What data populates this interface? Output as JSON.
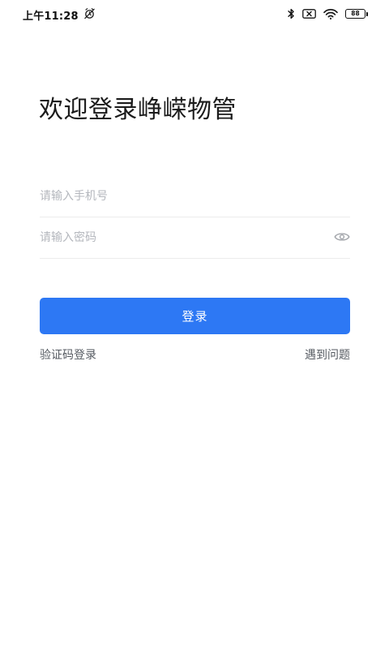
{
  "status_bar": {
    "time": "上午11:28",
    "left_icon": "alarm-off-icon",
    "icons": [
      "bluetooth-icon",
      "sim-x-icon",
      "wifi-icon"
    ],
    "battery_level": "88"
  },
  "login": {
    "title": "欢迎登录峥嵘物管",
    "phone_placeholder": "请输入手机号",
    "password_placeholder": "请输入密码",
    "password_toggle_icon": "eye-icon",
    "submit_label": "登录",
    "sms_login_label": "验证码登录",
    "help_label": "遇到问题"
  },
  "colors": {
    "primary": "#2d78f4",
    "placeholder": "#b4b7bd",
    "link": "#555a61",
    "divider": "#ececec"
  }
}
